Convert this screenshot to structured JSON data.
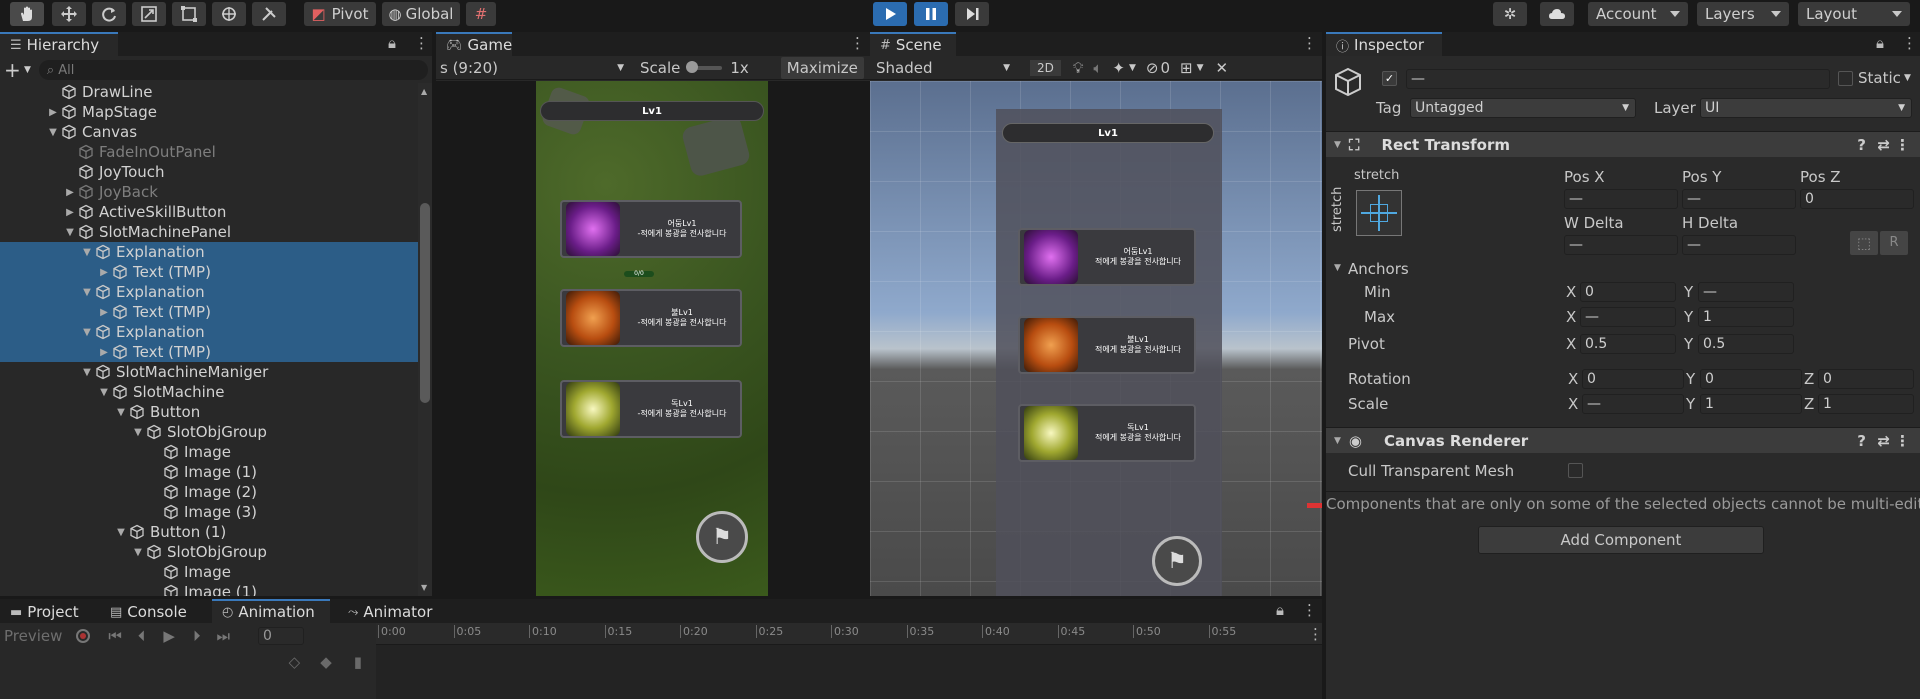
{
  "toolbar": {
    "pivot": "Pivot",
    "global": "Global",
    "account": "Account",
    "layers": "Layers",
    "layout": "Layout"
  },
  "hierarchy": {
    "tab": "Hierarchy",
    "search_placeholder": "All",
    "items": [
      {
        "label": "DrawLine",
        "depth": 3,
        "arrow": "",
        "dim": false,
        "selected": false
      },
      {
        "label": "MapStage",
        "depth": 3,
        "arrow": "▶",
        "dim": false,
        "selected": false
      },
      {
        "label": "Canvas",
        "depth": 3,
        "arrow": "▼",
        "dim": false,
        "selected": false
      },
      {
        "label": "FadeInOutPanel",
        "depth": 4,
        "arrow": "",
        "dim": true,
        "selected": false
      },
      {
        "label": "JoyTouch",
        "depth": 4,
        "arrow": "",
        "dim": false,
        "selected": false
      },
      {
        "label": "JoyBack",
        "depth": 4,
        "arrow": "▶",
        "dim": true,
        "selected": false
      },
      {
        "label": "ActiveSkillButton",
        "depth": 4,
        "arrow": "▶",
        "dim": false,
        "selected": false
      },
      {
        "label": "SlotMachinePanel",
        "depth": 4,
        "arrow": "▼",
        "dim": false,
        "selected": false
      },
      {
        "label": "Explanation",
        "depth": 5,
        "arrow": "▼",
        "dim": false,
        "selected": true
      },
      {
        "label": "Text (TMP)",
        "depth": 6,
        "arrow": "▶",
        "dim": false,
        "selected": true
      },
      {
        "label": "Explanation",
        "depth": 5,
        "arrow": "▼",
        "dim": false,
        "selected": true
      },
      {
        "label": "Text (TMP)",
        "depth": 6,
        "arrow": "▶",
        "dim": false,
        "selected": true
      },
      {
        "label": "Explanation",
        "depth": 5,
        "arrow": "▼",
        "dim": false,
        "selected": true
      },
      {
        "label": "Text (TMP)",
        "depth": 6,
        "arrow": "▶",
        "dim": false,
        "selected": true
      },
      {
        "label": "SlotMachineManiger",
        "depth": 5,
        "arrow": "▼",
        "dim": false,
        "selected": false
      },
      {
        "label": "SlotMachine",
        "depth": 6,
        "arrow": "▼",
        "dim": false,
        "selected": false
      },
      {
        "label": "Button",
        "depth": 7,
        "arrow": "▼",
        "dim": false,
        "selected": false
      },
      {
        "label": "SlotObjGroup",
        "depth": 8,
        "arrow": "▼",
        "dim": false,
        "selected": false
      },
      {
        "label": "Image",
        "depth": 9,
        "arrow": "",
        "dim": false,
        "selected": false
      },
      {
        "label": "Image (1)",
        "depth": 9,
        "arrow": "",
        "dim": false,
        "selected": false
      },
      {
        "label": "Image (2)",
        "depth": 9,
        "arrow": "",
        "dim": false,
        "selected": false
      },
      {
        "label": "Image (3)",
        "depth": 9,
        "arrow": "",
        "dim": false,
        "selected": false
      },
      {
        "label": "Button (1)",
        "depth": 7,
        "arrow": "▼",
        "dim": false,
        "selected": false
      },
      {
        "label": "SlotObjGroup",
        "depth": 8,
        "arrow": "▼",
        "dim": false,
        "selected": false
      },
      {
        "label": "Image",
        "depth": 9,
        "arrow": "",
        "dim": false,
        "selected": false
      },
      {
        "label": "Image (1)",
        "depth": 9,
        "arrow": "",
        "dim": false,
        "selected": false
      }
    ]
  },
  "game": {
    "tab": "Game",
    "resolution": "s (9:20)",
    "scale_label": "Scale",
    "scale_value": "1x",
    "maximize": "Maximize",
    "level": "Lv1",
    "exp": "0/0",
    "cards": [
      {
        "title": "어둠Lv1",
        "desc": "-적에게 봉광을 전사합니다"
      },
      {
        "title": "불Lv1",
        "desc": "-적에게 봉광을 전사합니다"
      },
      {
        "title": "독Lv1",
        "desc": "-적에게 봉광을 전사합니다"
      }
    ]
  },
  "scene": {
    "tab": "Scene",
    "shading": "Shaded",
    "mode2d": "2D",
    "hidden_count": "0",
    "level": "Lv1",
    "cards": [
      {
        "title": "어둠Lv1",
        "desc": "적에게 봉광을 전사합니다"
      },
      {
        "title": "불Lv1",
        "desc": "적에게 봉광을 전사합니다"
      },
      {
        "title": "독Lv1",
        "desc": "적에게 봉광을 전사합니다"
      }
    ]
  },
  "inspector": {
    "tab": "Inspector",
    "name_value": "—",
    "static_label": "Static",
    "tag_label": "Tag",
    "tag_value": "Untagged",
    "layer_label": "Layer",
    "layer_value": "UI",
    "rect_transform": {
      "title": "Rect Transform",
      "stretch_top": "stretch",
      "stretch_side": "stretch",
      "posx_label": "Pos X",
      "posy_label": "Pos Y",
      "posz_label": "Pos Z",
      "posx": "—",
      "posy": "—",
      "posz": "0",
      "wdelta_label": "W Delta",
      "hdelta_label": "H Delta",
      "wdelta": "—",
      "hdelta": "—",
      "r_button": "R",
      "anchors_label": "Anchors",
      "min_label": "Min",
      "max_label": "Max",
      "min_x": "0",
      "min_y": "—",
      "max_x": "—",
      "max_y": "1",
      "pivot_label": "Pivot",
      "pivot_x": "0.5",
      "pivot_y": "0.5",
      "rotation_label": "Rotation",
      "rot_x": "0",
      "rot_y": "0",
      "rot_z": "0",
      "scale_label": "Scale",
      "scale_x": "—",
      "scale_y": "1",
      "scale_z": "1",
      "x": "X",
      "y": "Y",
      "z": "Z"
    },
    "canvas_renderer": {
      "title": "Canvas Renderer",
      "cull_label": "Cull Transparent Mesh"
    },
    "note": "Components that are only on some of the selected objects cannot be multi-edited.",
    "add_component": "Add Component"
  },
  "bottom": {
    "tabs": [
      "Project",
      "Console",
      "Animation",
      "Animator"
    ],
    "preview": "Preview",
    "frame": "0",
    "ticks": [
      "0:00",
      "0:05",
      "0:10",
      "0:15",
      "0:20",
      "0:25",
      "0:30",
      "0:35",
      "0:40",
      "0:45",
      "0:50",
      "0:55"
    ]
  },
  "colors": {
    "accent": "#3a79bb",
    "selection": "#2c5d87",
    "panel": "#282828"
  }
}
